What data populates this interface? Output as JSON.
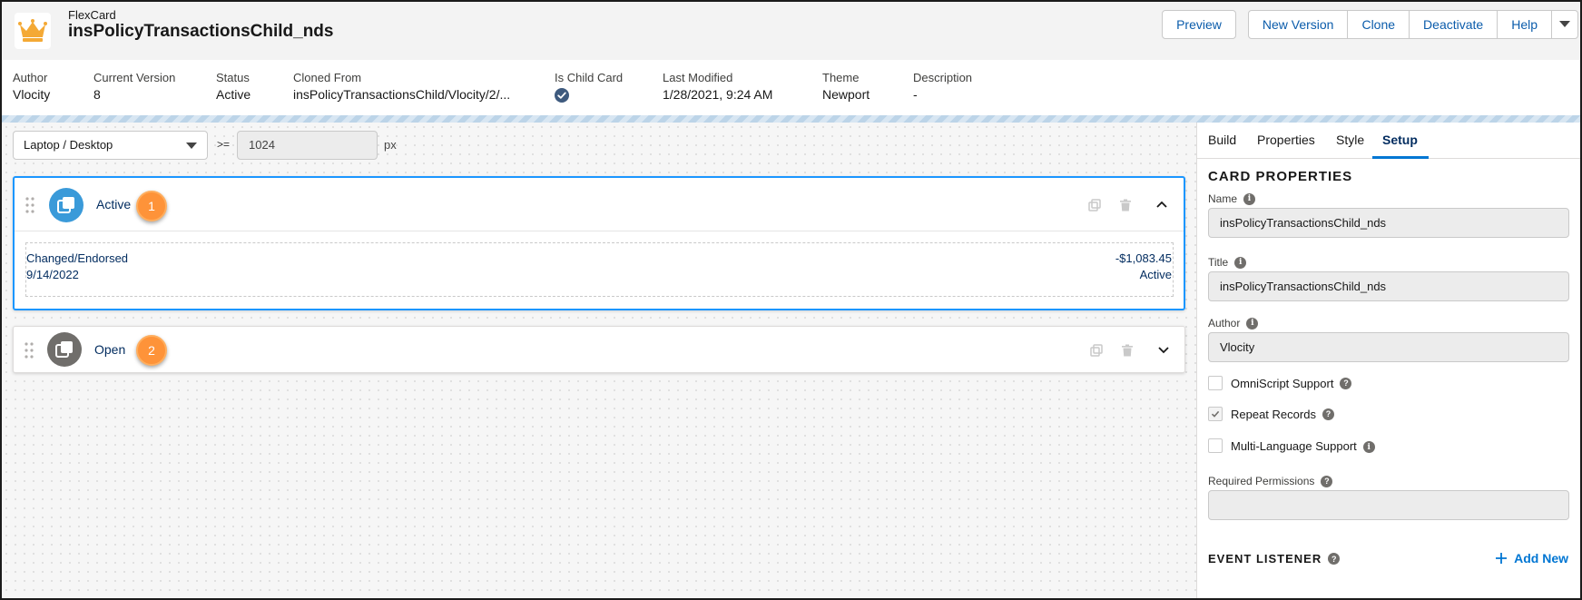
{
  "header": {
    "type_label": "FlexCard",
    "title": "insPolicyTransactionsChild_nds",
    "icon": "crown-icon",
    "buttons": {
      "preview": "Preview",
      "new_version": "New Version",
      "clone": "Clone",
      "deactivate": "Deactivate",
      "help": "Help"
    }
  },
  "meta": {
    "author_label": "Author",
    "author": "Vlocity",
    "version_label": "Current Version",
    "version": "8",
    "status_label": "Status",
    "status": "Active",
    "cloned_label": "Cloned From",
    "cloned": "insPolicyTransactionsChild/Vlocity/2/...",
    "child_label": "Is Child Card",
    "modified_label": "Last Modified",
    "modified": "1/28/2021, 9:24 AM",
    "theme_label": "Theme",
    "theme": "Newport",
    "description_label": "Description",
    "description": "-"
  },
  "toolbar": {
    "device": "Laptop / Desktop",
    "operator": ">=",
    "width": "1024",
    "unit": "px"
  },
  "cards": [
    {
      "name": "Active",
      "badge": "1",
      "rows": [
        {
          "left": "Changed/Endorsed",
          "right": "-$1,083.45"
        },
        {
          "left": "9/14/2022",
          "right": "Active"
        }
      ]
    },
    {
      "name": "Open",
      "badge": "2"
    }
  ],
  "panel": {
    "tabs": [
      "Build",
      "Properties",
      "Style",
      "Setup"
    ],
    "selected_tab": "Setup",
    "section_title": "CARD PROPERTIES",
    "name_label": "Name",
    "name_value": "insPolicyTransactionsChild_nds",
    "title_label": "Title",
    "title_value": "insPolicyTransactionsChild_nds",
    "author_label": "Author",
    "author_value": "Vlocity",
    "omniscript_label": "OmniScript Support",
    "repeat_label": "Repeat Records",
    "multilang_label": "Multi-Language Support",
    "permissions_label": "Required Permissions",
    "permissions_value": "",
    "event_title": "EVENT LISTENER",
    "add_new": "Add New"
  },
  "colors": {
    "accent": "#0176d3",
    "active_card_icon": "#3a9ad9",
    "open_card_icon": "#706e6b",
    "badge": "#fe9339"
  }
}
